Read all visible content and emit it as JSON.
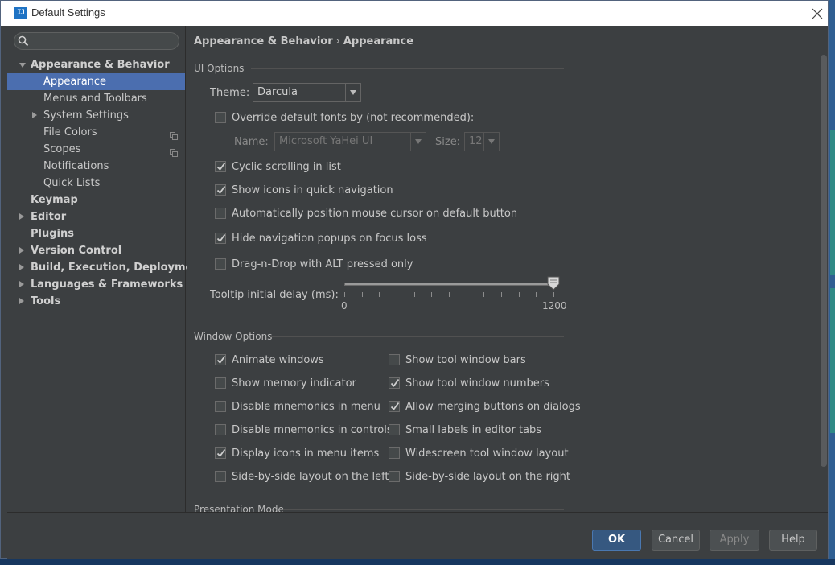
{
  "window": {
    "title": "Default Settings",
    "app_icon_text": "IJ",
    "close_icon": "close-icon"
  },
  "sidebar": {
    "search": {
      "value": "",
      "placeholder": "",
      "icon": "search-icon"
    },
    "items": [
      {
        "label": "Appearance & Behavior",
        "bold": true,
        "arrow": "down",
        "selected": false
      },
      {
        "label": "Appearance",
        "bold": false,
        "arrow": "none",
        "selected": true
      },
      {
        "label": "Menus and Toolbars",
        "bold": false,
        "arrow": "none",
        "selected": false
      },
      {
        "label": "System Settings",
        "bold": false,
        "arrow": "right",
        "selected": false
      },
      {
        "label": "File Colors",
        "bold": false,
        "arrow": "none",
        "selected": false,
        "icon": "copy-icon"
      },
      {
        "label": "Scopes",
        "bold": false,
        "arrow": "none",
        "selected": false,
        "icon": "copy-icon"
      },
      {
        "label": "Notifications",
        "bold": false,
        "arrow": "none",
        "selected": false
      },
      {
        "label": "Quick Lists",
        "bold": false,
        "arrow": "none",
        "selected": false
      },
      {
        "label": "Keymap",
        "bold": true,
        "arrow": "none",
        "selected": false
      },
      {
        "label": "Editor",
        "bold": true,
        "arrow": "right",
        "selected": false
      },
      {
        "label": "Plugins",
        "bold": true,
        "arrow": "none",
        "selected": false
      },
      {
        "label": "Version Control",
        "bold": true,
        "arrow": "right",
        "selected": false
      },
      {
        "label": "Build, Execution, Deployment",
        "bold": true,
        "arrow": "right",
        "selected": false
      },
      {
        "label": "Languages & Frameworks",
        "bold": true,
        "arrow": "right",
        "selected": false
      },
      {
        "label": "Tools",
        "bold": true,
        "arrow": "right",
        "selected": false
      }
    ]
  },
  "breadcrumb": {
    "parent": "Appearance & Behavior",
    "separator": "›",
    "current": "Appearance"
  },
  "ui_options": {
    "heading": "UI Options",
    "theme_label": "Theme:",
    "theme_value": "Darcula",
    "override_fonts": {
      "label": "Override default fonts by (not recommended):",
      "checked": false
    },
    "font_name_label": "Name:",
    "font_name_value": "Microsoft YaHei UI",
    "font_size_label": "Size:",
    "font_size_value": "12",
    "options": [
      {
        "label": "Cyclic scrolling in list",
        "checked": true
      },
      {
        "label": "Show icons in quick navigation",
        "checked": true
      },
      {
        "label": "Automatically position mouse cursor on default button",
        "checked": false
      },
      {
        "label": "Hide navigation popups on focus loss",
        "checked": true
      },
      {
        "label": "Drag-n-Drop with ALT pressed only",
        "checked": false
      }
    ],
    "tooltip_label": "Tooltip initial delay (ms):",
    "tooltip_min": "0",
    "tooltip_max": "1200",
    "tooltip_value_fraction": 1.0
  },
  "window_options": {
    "heading": "Window Options",
    "left": [
      {
        "label": "Animate windows",
        "checked": true
      },
      {
        "label": "Show memory indicator",
        "checked": false
      },
      {
        "label": "Disable mnemonics in menu",
        "checked": false
      },
      {
        "label": "Disable mnemonics in controls",
        "checked": false
      },
      {
        "label": "Display icons in menu items",
        "checked": true
      },
      {
        "label": "Side-by-side layout on the left",
        "checked": false
      }
    ],
    "right": [
      {
        "label": "Show tool window bars",
        "checked": false
      },
      {
        "label": "Show tool window numbers",
        "checked": true
      },
      {
        "label": "Allow merging buttons on dialogs",
        "checked": true
      },
      {
        "label": "Small labels in editor tabs",
        "checked": false
      },
      {
        "label": "Widescreen tool window layout",
        "checked": false
      },
      {
        "label": "Side-by-side layout on the right",
        "checked": false
      }
    ]
  },
  "presentation_mode": {
    "heading": "Presentation Mode"
  },
  "footer": {
    "ok_label": "OK",
    "cancel_label": "Cancel",
    "apply_label": "Apply",
    "help_label": "Help"
  },
  "colors": {
    "background": "#3c3f41",
    "selection": "#4b6eaf",
    "primary_button": "#365880",
    "text": "#c8c8c8"
  }
}
